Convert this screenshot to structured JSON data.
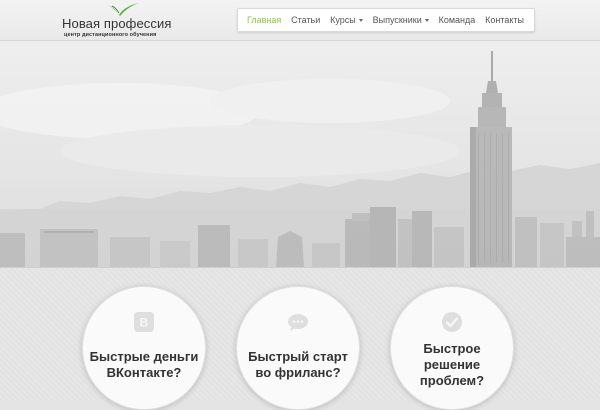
{
  "brand": {
    "name": "Новая профессия",
    "tagline": "центр дистанционного обучения",
    "accent_color": "#8dc63f"
  },
  "nav": {
    "items": [
      {
        "label": "Главная",
        "active": true,
        "dropdown": false
      },
      {
        "label": "Статьи",
        "active": false,
        "dropdown": false
      },
      {
        "label": "Курсы",
        "active": false,
        "dropdown": true
      },
      {
        "label": "Выпускники",
        "active": false,
        "dropdown": true
      },
      {
        "label": "Команда",
        "active": false,
        "dropdown": false
      },
      {
        "label": "Контакты",
        "active": false,
        "dropdown": false
      }
    ]
  },
  "hero": {
    "image": "city-skyline"
  },
  "cards": [
    {
      "icon": "vk-icon",
      "lines": [
        "Быстрые деньги",
        "ВКонтакте?"
      ]
    },
    {
      "icon": "chat-icon",
      "lines": [
        "Быстрый старт",
        "во фриланс?"
      ]
    },
    {
      "icon": "check-icon",
      "lines": [
        "Быстрое",
        "решение",
        "проблем?"
      ]
    }
  ]
}
